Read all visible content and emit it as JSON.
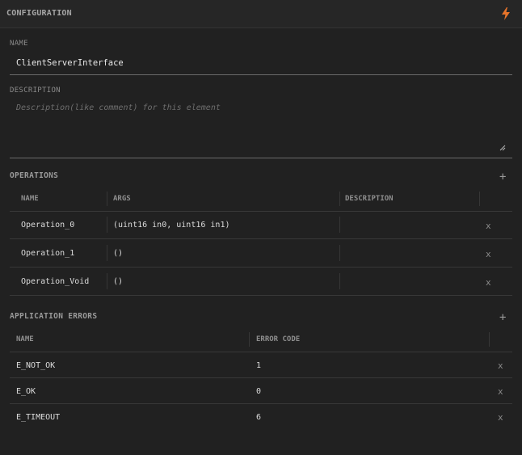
{
  "header": {
    "title": "CONFIGURATION",
    "icon": "lightning-icon",
    "icon_color": "#e8742a"
  },
  "name_field": {
    "label": "NAME",
    "value": "ClientServerInterface"
  },
  "description_field": {
    "label": "DESCRIPTION",
    "placeholder": "Description(like comment) for this element",
    "value": ""
  },
  "operations": {
    "title": "OPERATIONS",
    "add_label": "+",
    "columns": [
      "NAME",
      "ARGS",
      "DESCRIPTION"
    ],
    "rows": [
      {
        "name": "Operation_0",
        "args": "(uint16 in0, uint16 in1)",
        "description": "",
        "remove": "x"
      },
      {
        "name": "Operation_1",
        "args": "()",
        "description": "",
        "remove": "x"
      },
      {
        "name": "Operation_Void",
        "args": "()",
        "description": "",
        "remove": "x"
      }
    ]
  },
  "application_errors": {
    "title": "APPLICATION ERRORS",
    "add_label": "+",
    "columns": [
      "NAME",
      "ERROR CODE"
    ],
    "rows": [
      {
        "name": "E_NOT_OK",
        "code": "1",
        "remove": "x"
      },
      {
        "name": "E_OK",
        "code": "0",
        "remove": "x"
      },
      {
        "name": "E_TIMEOUT",
        "code": "6",
        "remove": "x"
      }
    ]
  },
  "colors": {
    "background": "#212121",
    "header": "#262626",
    "accent": "#e8742a"
  }
}
